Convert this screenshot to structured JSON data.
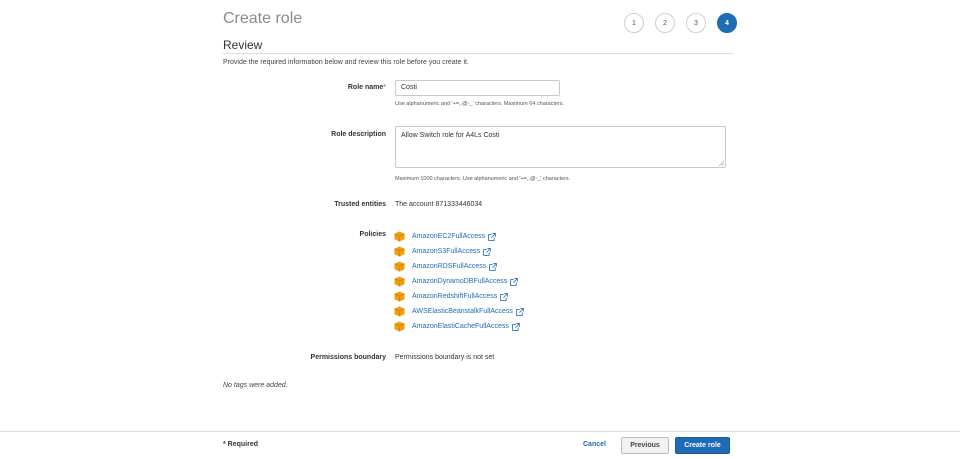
{
  "header": {
    "title": "Create role",
    "steps": [
      "1",
      "2",
      "3",
      "4"
    ],
    "active_step": "4"
  },
  "section": {
    "title": "Review",
    "intro": "Provide the required information below and review this role before you create it."
  },
  "form": {
    "role_name": {
      "label": "Role name",
      "required_mark": "*",
      "value": "Costi",
      "hint": "Use alphanumeric and '+=,.@-_' characters. Maximum 64 characters."
    },
    "role_description": {
      "label": "Role description",
      "value": "Allow Switch role for A4Ls Costi",
      "hint": "Maximum 1000 characters. Use alphanumeric and '+=,.@-_' characters."
    },
    "trusted_entities": {
      "label": "Trusted entities",
      "value": "The account 871333446034"
    },
    "policies": {
      "label": "Policies",
      "items": [
        "AmazonEC2FullAccess",
        "AmazonS3FullAccess",
        "AmazonRDSFullAccess",
        "AmazonDynamoDBFullAccess",
        "AmazonRedshiftFullAccess",
        "AWSElasticBeanstalkFullAccess",
        "AmazonElastiCacheFullAccess"
      ],
      "icon": "policy-cube-icon",
      "link_icon": "external-link-icon"
    },
    "permissions_boundary": {
      "label": "Permissions boundary",
      "value": "Permissions boundary is not set"
    },
    "tags_note": "No tags were added."
  },
  "footer": {
    "required_note": "* Required",
    "cancel_label": "Cancel",
    "previous_label": "Previous",
    "create_label": "Create role"
  },
  "colors": {
    "accent": "#1f6bb6",
    "policy_icon": "#f0a00c",
    "required": "#d13212"
  }
}
